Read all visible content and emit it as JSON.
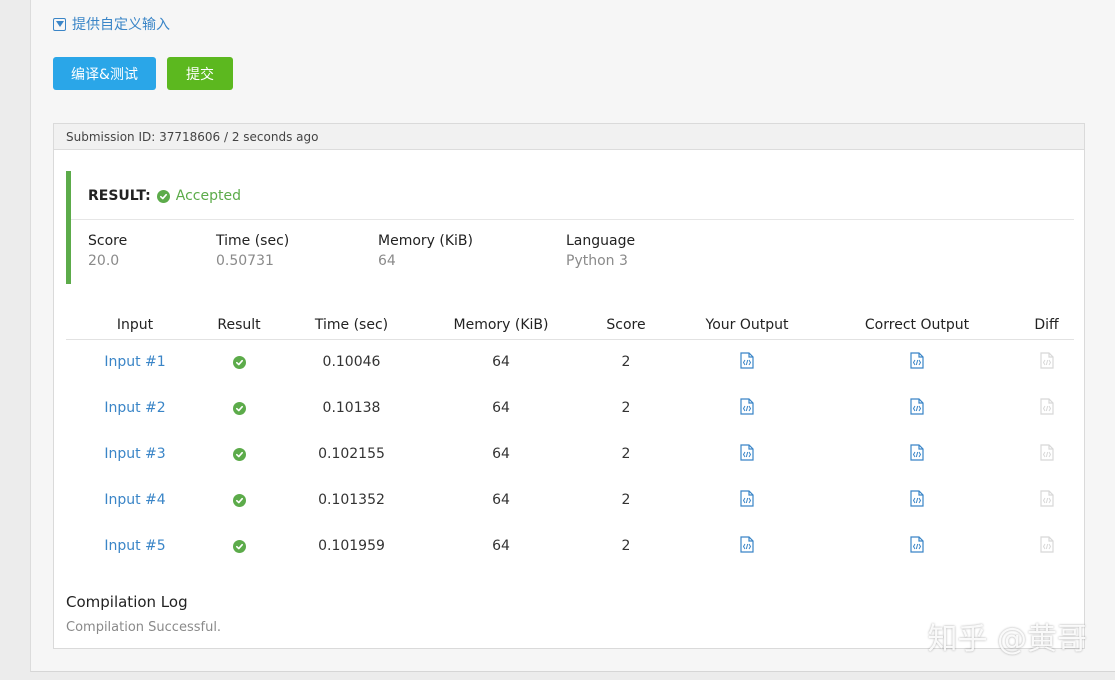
{
  "custom_input": {
    "label": "提供自定义输入"
  },
  "buttons": {
    "compile": "编译&测试",
    "submit": "提交"
  },
  "submission": {
    "header": "Submission ID: 37718606 / 2 seconds ago"
  },
  "result": {
    "label": "RESULT:",
    "status": "Accepted",
    "stats": [
      {
        "key": "Score",
        "value": "20.0"
      },
      {
        "key": "Time (sec)",
        "value": "0.50731"
      },
      {
        "key": "Memory (KiB)",
        "value": "64"
      },
      {
        "key": "Language",
        "value": "Python 3"
      }
    ]
  },
  "table": {
    "headers": [
      "Input",
      "Result",
      "Time (sec)",
      "Memory (KiB)",
      "Score",
      "Your Output",
      "Correct Output",
      "Diff"
    ],
    "rows": [
      {
        "input": "Input #1",
        "time": "0.10046",
        "memory": "64",
        "score": "2"
      },
      {
        "input": "Input #2",
        "time": "0.10138",
        "memory": "64",
        "score": "2"
      },
      {
        "input": "Input #3",
        "time": "0.102155",
        "memory": "64",
        "score": "2"
      },
      {
        "input": "Input #4",
        "time": "0.101352",
        "memory": "64",
        "score": "2"
      },
      {
        "input": "Input #5",
        "time": "0.101959",
        "memory": "64",
        "score": "2"
      }
    ]
  },
  "compilation": {
    "title": "Compilation Log",
    "text": "Compilation Successful."
  },
  "watermark": "知乎 @黄哥",
  "colors": {
    "accent_blue": "#2aa6e8",
    "submit_green": "#5cb81f",
    "accepted_green": "#5cab4a",
    "link_blue": "#3a85c7"
  }
}
